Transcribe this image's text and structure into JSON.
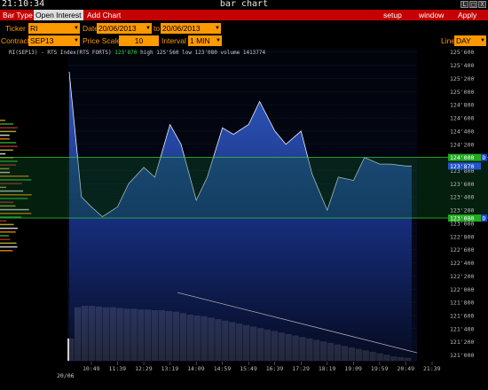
{
  "window": {
    "clock": "21:10:34",
    "title": "bar chart",
    "buttons": [
      "L",
      "□",
      "X"
    ]
  },
  "menu": {
    "bar_type": "Bar Type",
    "open_interest": "Open Interest",
    "add_chart": "Add Chart",
    "setup": "setup",
    "window": "window",
    "apply": "Apply"
  },
  "toolbar": {
    "ticker_label": "Ticker",
    "ticker_value": "RI",
    "date_label": "Date",
    "date_from": "20/06/2013",
    "to_label": "to",
    "date_to": "20/06/2013",
    "contract_label": "Contract",
    "contract_value": "SEP13",
    "price_scale_label": "Price Scale",
    "price_scale_value": "10",
    "interval_label": "Interval",
    "interval_value": "1 MIN",
    "line_label": "Line",
    "line_value": "DAY"
  },
  "info": {
    "symbol": "RI(SEP13) - RTS Index(RTS FORTS)",
    "last": "123'870",
    "high_label": "high",
    "high": "125'560",
    "low_label": "low",
    "low": "123'080",
    "volume_label": "volume",
    "volume": "1413774"
  },
  "chart_data": {
    "type": "area",
    "y_ticks": [
      "125'600",
      "125'400",
      "125'200",
      "125'000",
      "124'800",
      "124'600",
      "124'400",
      "124'200",
      "124'000",
      "123'800",
      "123'600",
      "123'400",
      "123'200",
      "123'000",
      "122'800",
      "122'600",
      "122'400",
      "122'200",
      "122'000",
      "121'800",
      "121'600",
      "121'400",
      "121'200",
      "121'000"
    ],
    "x_ticks": [
      "10:49",
      "11:39",
      "12:29",
      "13:19",
      "14:09",
      "14:59",
      "15:49",
      "16:39",
      "17:29",
      "18:19",
      "19:09",
      "19:59",
      "20:49",
      "21:39"
    ],
    "date": "20/06",
    "ylim": [
      120900,
      125650
    ],
    "price_tags": [
      {
        "value": "124'000",
        "color": "#22aa22",
        "side": "D"
      },
      {
        "value": "123'870",
        "color": "#2255cc"
      },
      {
        "value": "123'080",
        "color": "#22aa22",
        "side": "D"
      }
    ],
    "price_series": {
      "times": [
        "10:00",
        "10:30",
        "10:49",
        "11:10",
        "11:39",
        "12:00",
        "12:29",
        "12:50",
        "13:19",
        "13:40",
        "14:09",
        "14:30",
        "14:59",
        "15:20",
        "15:49",
        "16:10",
        "16:39",
        "17:00",
        "17:29",
        "17:50",
        "18:19",
        "18:40",
        "19:09",
        "19:30",
        "19:59",
        "20:20",
        "20:49",
        "21:00"
      ],
      "values": [
        125300,
        123400,
        123250,
        123100,
        123250,
        123600,
        123850,
        123700,
        124500,
        124200,
        123350,
        123700,
        124450,
        124350,
        124500,
        124850,
        124400,
        124200,
        124400,
        123750,
        123200,
        123700,
        123650,
        124000,
        123900,
        123900,
        123870,
        123870
      ]
    },
    "volume_series": {
      "note_hidden": false,
      "values": [
        300,
        720,
        740,
        740,
        730,
        720,
        720,
        710,
        700,
        700,
        690,
        690,
        680,
        680,
        670,
        660,
        640,
        620,
        610,
        600,
        580,
        560,
        540,
        520,
        500,
        480,
        460,
        440,
        420,
        400,
        380,
        360,
        340,
        320,
        300,
        280,
        260,
        240,
        220,
        200,
        180,
        160,
        140,
        120,
        100,
        80,
        60,
        50,
        40
      ]
    },
    "high_line": "124'000",
    "low_line": "123'080"
  }
}
